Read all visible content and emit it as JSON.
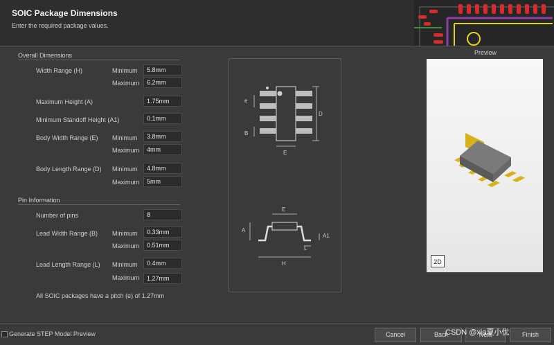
{
  "header": {
    "title": "SOIC Package Dimensions",
    "subtitle": "Enter the required package values."
  },
  "overall": {
    "section_label": "Overall Dimensions",
    "width_label": "Width Range (H)",
    "max_height_label": "Maximum Height (A)",
    "standoff_label": "Minimum Standoff Height (A1)",
    "body_width_label": "Body Width Range (E)",
    "body_length_label": "Body Length Range (D)",
    "minimum_label": "Minimum",
    "maximum_label": "Maximum",
    "width_min": "5.8mm",
    "width_max": "6.2mm",
    "max_height": "1.75mm",
    "standoff": "0.1mm",
    "body_width_min": "3.8mm",
    "body_width_max": "4mm",
    "body_length_min": "4.8mm",
    "body_length_max": "5mm"
  },
  "pins": {
    "section_label": "Pin Information",
    "number_label": "Number of pins",
    "number": "8",
    "lead_width_label": "Lead Width Range (B)",
    "lead_length_label": "Lead Length Range (L)",
    "lead_width_min": "0.33mm",
    "lead_width_max": "0.51mm",
    "lead_length_min": "0.4mm",
    "lead_length_max": "1.27mm",
    "pitch_note": "All SOIC packages have a pitch (e) of 1.27mm"
  },
  "diagram": {
    "top": {
      "e": "e",
      "b": "B",
      "d": "D",
      "e_body": "E"
    },
    "side": {
      "e_top": "E",
      "a": "A",
      "a1": "A1",
      "l": "L",
      "h": "H"
    }
  },
  "preview": {
    "label": "Preview",
    "mode_button": "2D"
  },
  "footer": {
    "step_checkbox_label": "Generate STEP Model Preview",
    "cancel": "Cancel",
    "back": "Back",
    "next": "Next",
    "finish": "Finish",
    "watermark": "CSDN @xia夏小优"
  },
  "colors": {
    "background": "#3a3a3a",
    "header": "#2e2e2e",
    "field": "#2b2b2b",
    "pcb_red": "#d42b2b",
    "pcb_purple": "#8a3fa8",
    "pcb_yellow": "#e6d21e",
    "chip_gray": "#707070",
    "lead_gold": "#d8b21a"
  }
}
